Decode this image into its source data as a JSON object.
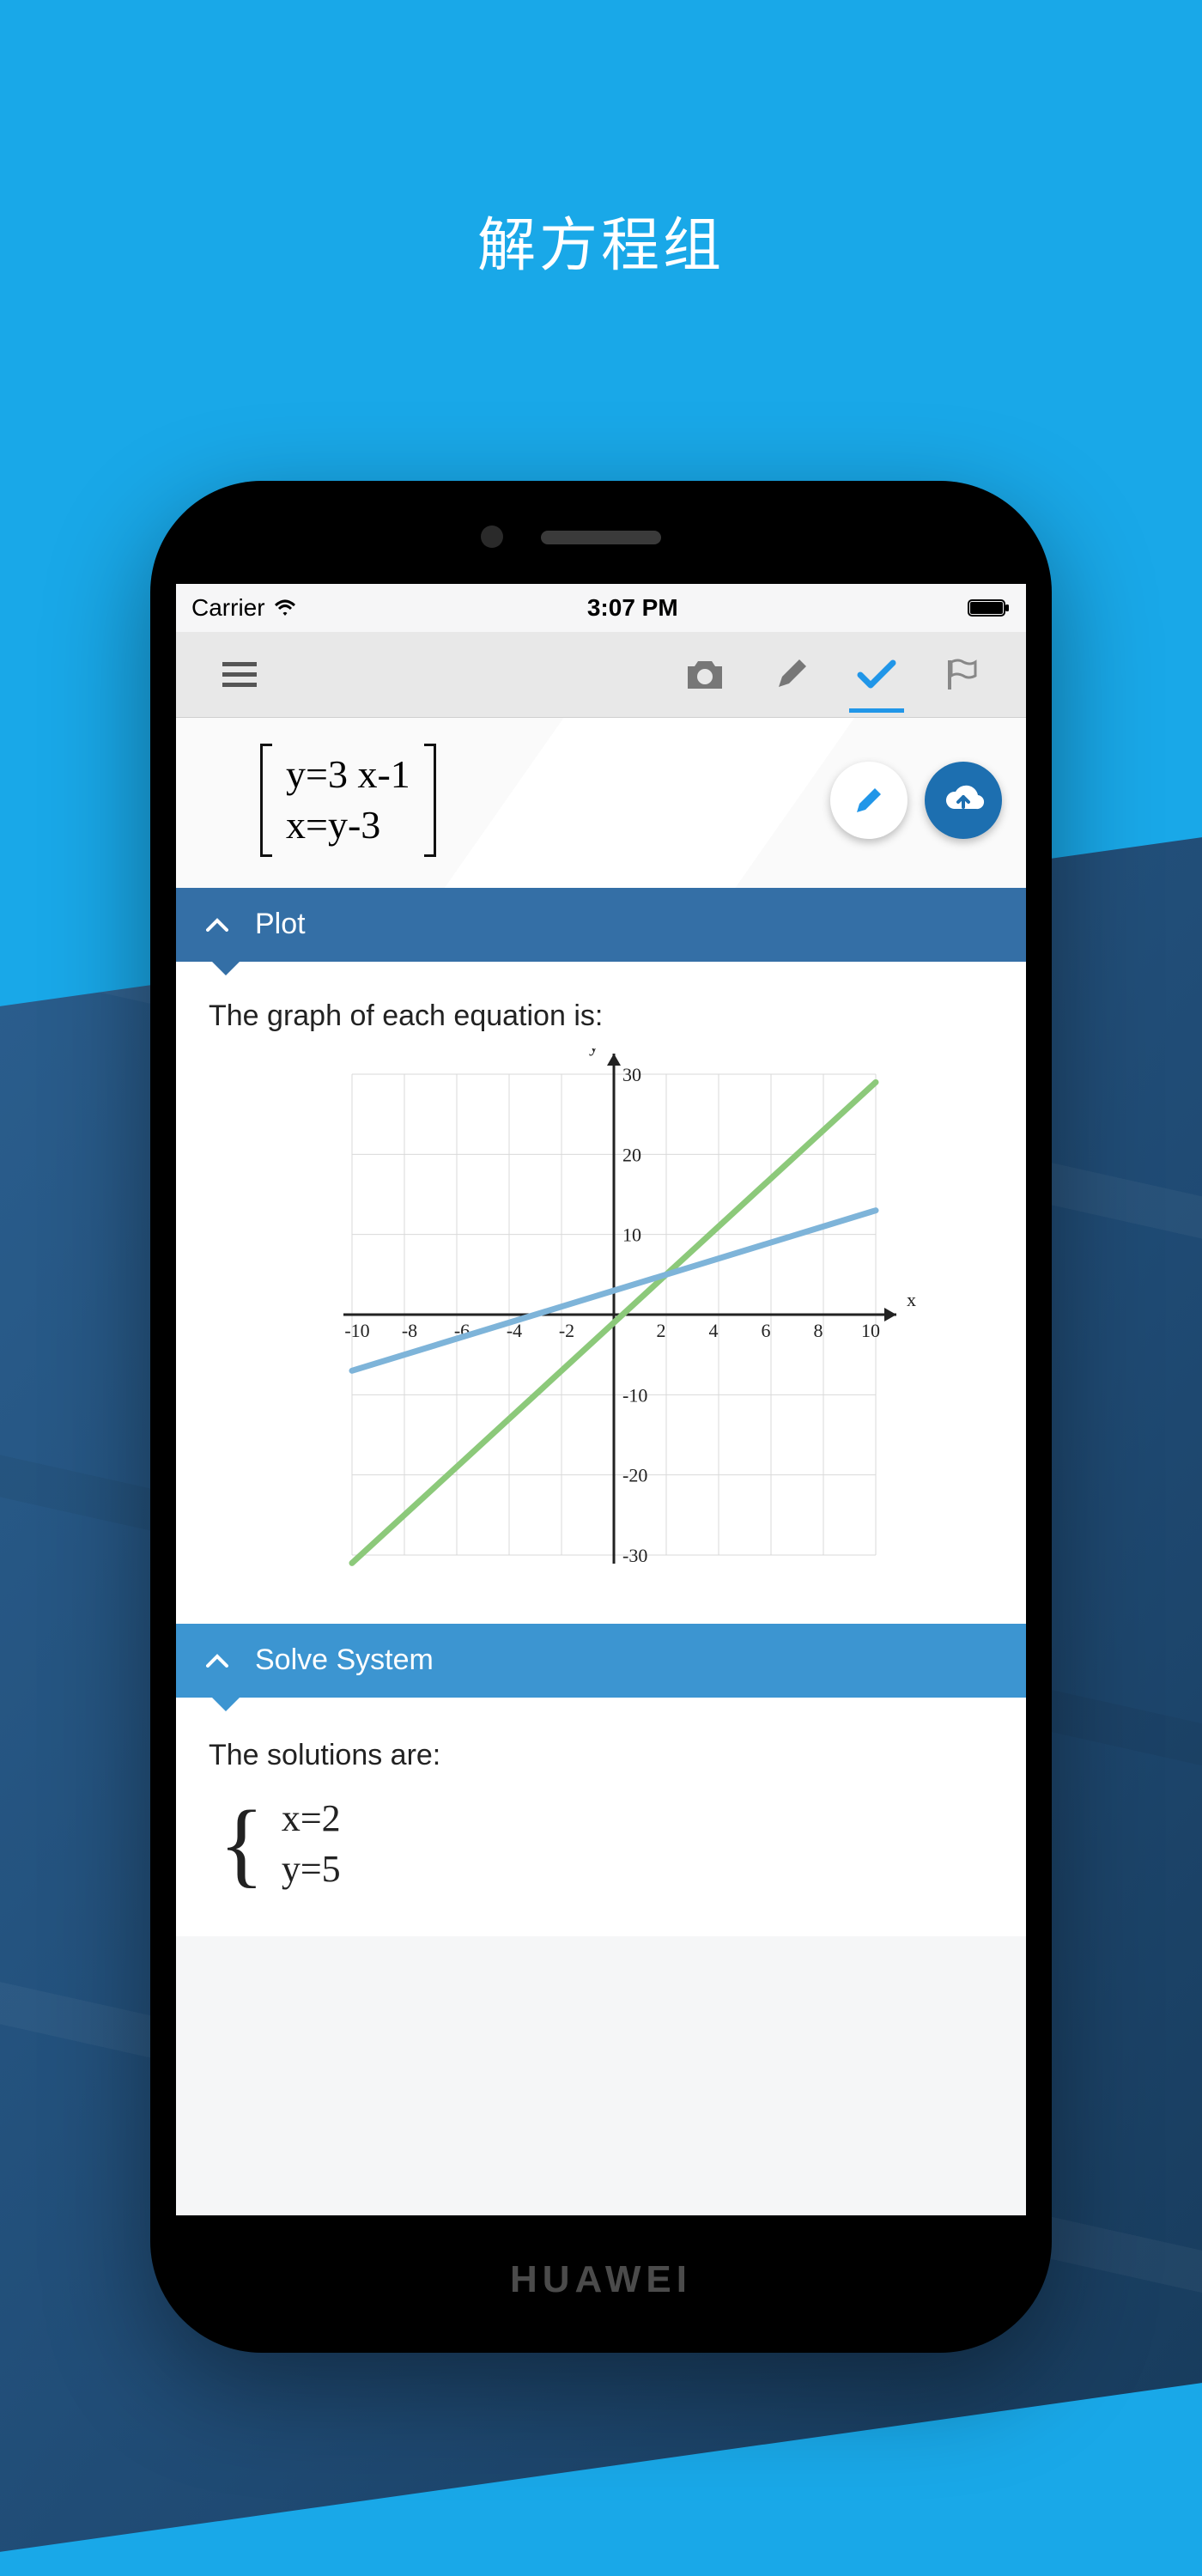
{
  "page_title": "解方程组",
  "phone_brand": "HUAWEI",
  "status": {
    "carrier": "Carrier",
    "time": "3:07 PM"
  },
  "equations": {
    "line1": "y=3 x-1",
    "line2": "x=y-3"
  },
  "sections": {
    "plot": {
      "title": "Plot",
      "desc": "The graph of each equation is:"
    },
    "solve": {
      "title": "Solve System",
      "desc": "The solutions are:"
    }
  },
  "solutions": {
    "x": "x=2",
    "y": "y=5"
  },
  "chart_data": {
    "type": "line",
    "xlabel": "x",
    "ylabel": "y",
    "xlim": [
      -10,
      10
    ],
    "ylim": [
      -30,
      30
    ],
    "xticks": [
      -10,
      -8,
      -6,
      -4,
      -2,
      2,
      4,
      6,
      8,
      10
    ],
    "yticks": [
      -30,
      -20,
      -10,
      10,
      20,
      30
    ],
    "series": [
      {
        "name": "y = 3x - 1",
        "color": "#8cc97a",
        "points": [
          [
            -10,
            -31
          ],
          [
            10,
            29
          ]
        ]
      },
      {
        "name": "y = x + 3",
        "color": "#7eb4d9",
        "points": [
          [
            -10,
            -7
          ],
          [
            10,
            13
          ]
        ]
      }
    ]
  }
}
